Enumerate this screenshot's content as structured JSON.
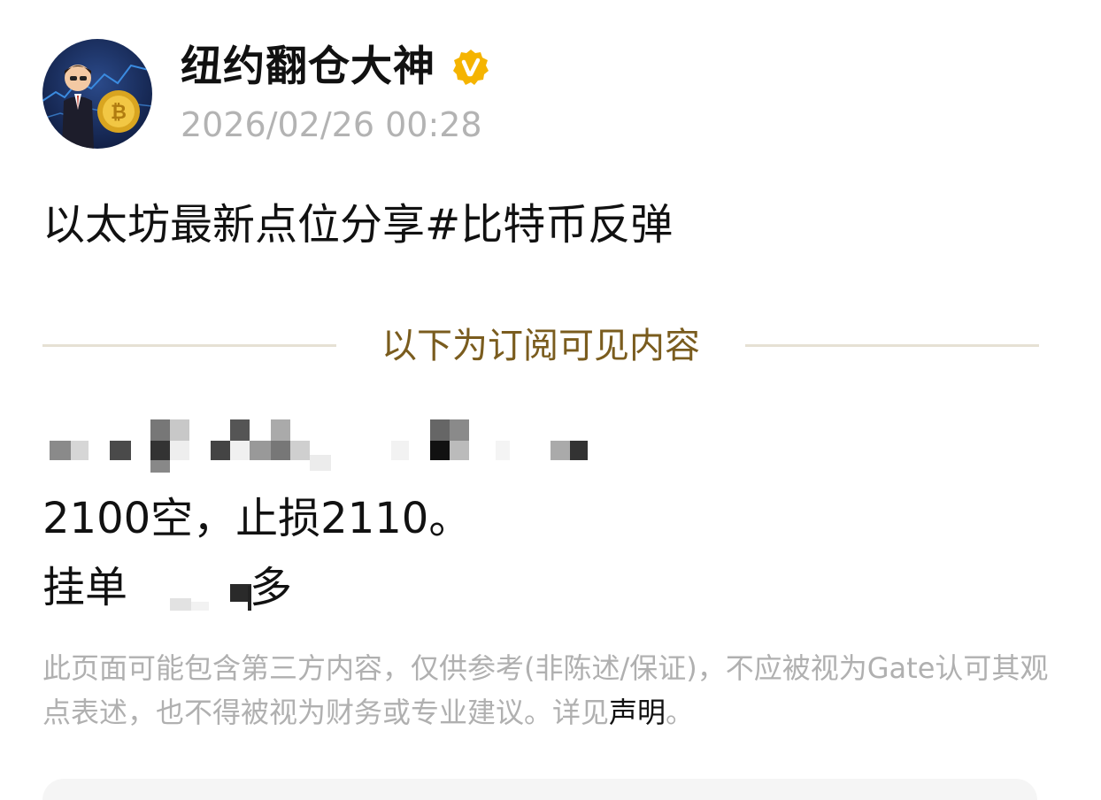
{
  "author": {
    "name": "纽约翻仓大神",
    "verified_icon": "verified-badge-icon",
    "verified_color": "#f5b400"
  },
  "post": {
    "time": "2026/02/26 00:28",
    "text": "以太坊最新点位分享#比特币反弹"
  },
  "subscription_divider": {
    "label": "以下为订阅可见内容",
    "label_color": "#7a5c1e"
  },
  "content": {
    "line_1": "2100空，止损2110。",
    "line_2_prefix": "挂单",
    "line_2_suffix": "多"
  },
  "disclaimer": {
    "text": "此页面可能包含第三方内容，仅供参考(非陈述/保证)，不应被视为Gate认可其观点表述，也不得被视为财务或专业建议。详见",
    "link_text": "声明",
    "end": "。"
  }
}
